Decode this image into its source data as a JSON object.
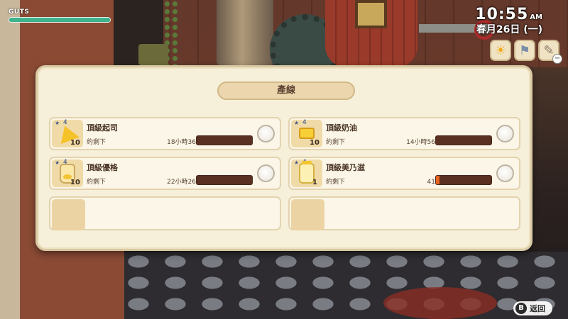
{
  "hud": {
    "guts_label": "GUTS",
    "guts_level": 1.0,
    "time": "10:55",
    "ampm": "AM",
    "date": "春月26日 (一)",
    "weather_icon": "sun-icon",
    "wind_icon": "wind-flag-icon",
    "tool_icon": "tool-icon",
    "tool_badge": "−"
  },
  "panel": {
    "title": "產線",
    "slots": [
      {
        "name": "頂級起司",
        "qty": "10",
        "remain_label": "約剩下",
        "time": "18小時36分鐘",
        "progress": 0.0,
        "icon": "cheese-icon"
      },
      {
        "name": "頂級奶油",
        "qty": "10",
        "remain_label": "約剩下",
        "time": "14小時56分鐘",
        "progress": 0.0,
        "icon": "butter-icon"
      },
      {
        "name": "頂級優格",
        "qty": "10",
        "remain_label": "約剩下",
        "time": "22小時26分鐘",
        "progress": 0.0,
        "icon": "yogurt-icon"
      },
      {
        "name": "頂級美乃滋",
        "qty": "1",
        "remain_label": "約剩下",
        "time": "41分鐘",
        "progress": 0.06,
        "icon": "mayonnaise-icon"
      }
    ]
  },
  "footer": {
    "back_button_key": "B",
    "back_label": "返回"
  },
  "colors": {
    "panel_bg": "#f6efd9",
    "bar_dark": "#5a3022",
    "bar_progress": "#e8641e",
    "guts_fill": "#3fb48c"
  }
}
